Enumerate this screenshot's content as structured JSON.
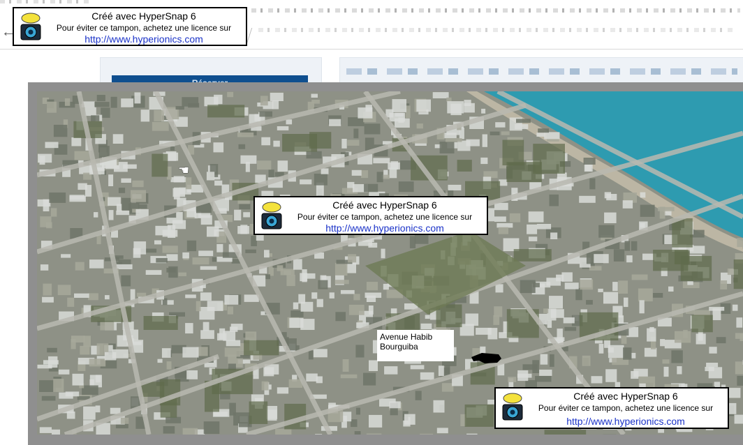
{
  "browser": {
    "back_icon": "←",
    "address_fragment": "/"
  },
  "page": {
    "reserve_button_label": "Réserver"
  },
  "map": {
    "street_label": "Avenue Habib\nBourguiba",
    "cursor_icon": "hand-pointer-icon",
    "colors": {
      "sea": "#2e9bb0",
      "shore": "#bcb6a4",
      "urban": "#8e9186",
      "roof": "#d9dcd8",
      "road": "#b9b9b0"
    }
  },
  "watermarks": [
    {
      "line1": "Créé avec HyperSnap 6",
      "line2": "Pour éviter ce tampon, achetez une licence sur",
      "line3": "http://www.hyperionics.com"
    },
    {
      "line1": "Créé avec HyperSnap 6",
      "line2": "Pour éviter ce tampon, achetez une licence sur",
      "line3": "http://www.hyperionics.com"
    },
    {
      "line1": "Créé avec HyperSnap 6",
      "line2": "Pour éviter ce tampon, achetez une licence sur",
      "line3": "http://www.hyperionics.com"
    }
  ]
}
